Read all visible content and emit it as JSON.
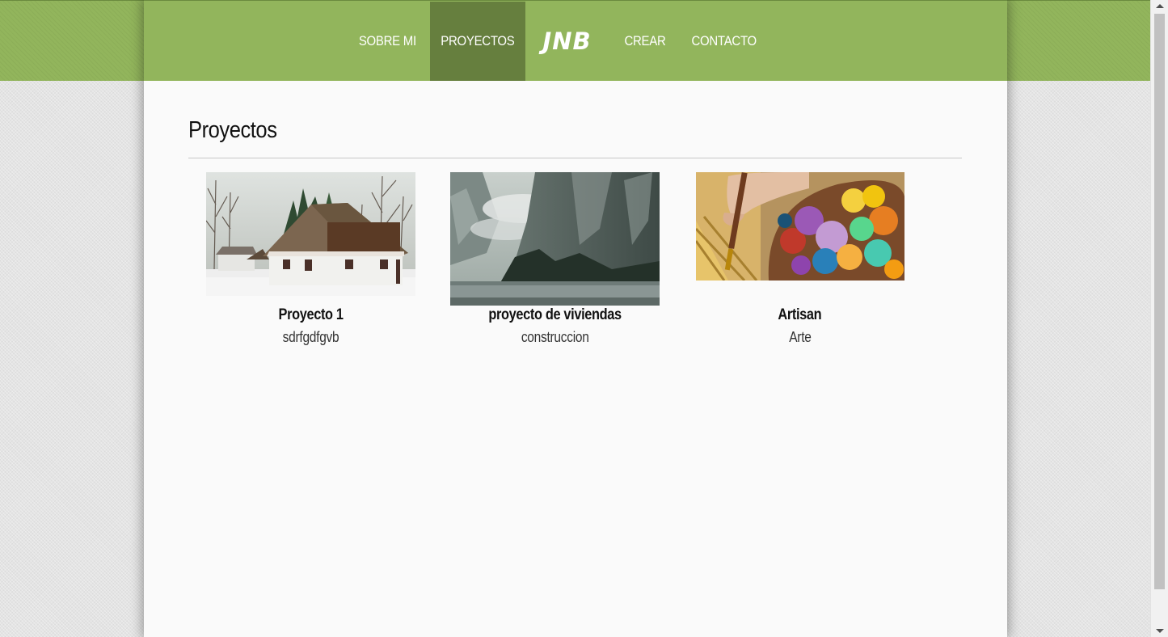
{
  "nav": {
    "left_items": [
      {
        "label": "SOBRE MI"
      },
      {
        "label": "PROYECTOS"
      }
    ],
    "brand": "JNB",
    "right_items": [
      {
        "label": "CREAR"
      },
      {
        "label": "CONTACTO"
      }
    ],
    "active": "PROYECTOS"
  },
  "main": {
    "heading": "Proyectos",
    "projects": [
      {
        "name": "Proyecto 1",
        "subtitle": "sdrfgdfgvb",
        "image": "house-image"
      },
      {
        "name": "proyecto de viviendas",
        "subtitle": "construccion",
        "image": "mountain-lake-image"
      },
      {
        "name": "Artisan",
        "subtitle": "Arte",
        "image": "paint-palette-image"
      }
    ]
  },
  "colors": {
    "nav_bg": "#92b55c",
    "nav_active_bg": "#667f3e",
    "page_bg": "#fafafa"
  }
}
